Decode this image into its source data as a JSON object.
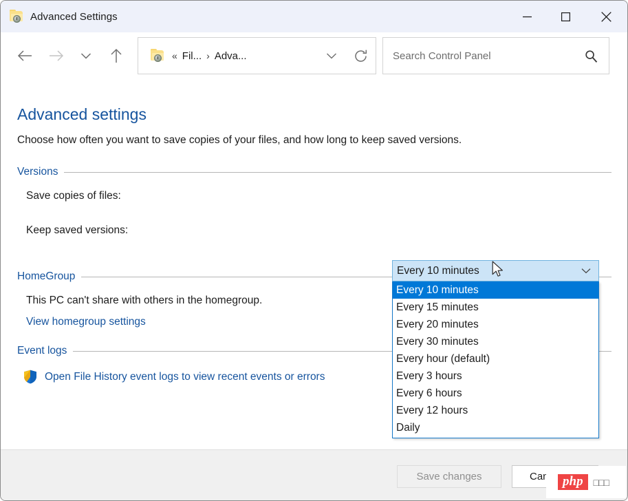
{
  "window": {
    "title": "Advanced Settings",
    "icon": "file-history-folder-icon",
    "controls": {
      "minimize": "minimize-icon",
      "maximize": "maximize-icon",
      "close": "close-icon"
    }
  },
  "toolbar": {
    "back": "back-arrow-icon",
    "forward": "forward-arrow-icon",
    "recent": "chevron-down-icon",
    "up": "up-arrow-icon",
    "address": {
      "icon": "file-history-folder-icon",
      "overflow": "«",
      "crumbs": [
        "Fil...",
        "Adva..."
      ],
      "separator": "›",
      "dropdown": "chevron-down-icon",
      "refresh": "refresh-icon"
    },
    "search": {
      "placeholder": "Search Control Panel",
      "value": "",
      "icon": "search-icon"
    }
  },
  "page": {
    "title": "Advanced settings",
    "subtitle": "Choose how often you want to save copies of your files, and how long to keep saved versions."
  },
  "groups": {
    "versions": {
      "label": "Versions",
      "save_copies_label": "Save copies of files:",
      "keep_versions_label": "Keep saved versions:"
    },
    "homegroup": {
      "label": "HomeGroup",
      "text": "This PC can't share with others in the homegroup.",
      "link": "View homegroup settings"
    },
    "event_logs": {
      "label": "Event logs",
      "shield_icon": "uac-shield-icon",
      "link": "Open File History event logs to view recent events or errors"
    }
  },
  "combo": {
    "selected_value": "Every 10 minutes",
    "chevron": "chevron-down-icon",
    "options": [
      "Every 10 minutes",
      "Every 15 minutes",
      "Every 20 minutes",
      "Every 30 minutes",
      "Every hour (default)",
      "Every 3 hours",
      "Every 6 hours",
      "Every 12 hours",
      "Daily"
    ],
    "selected_index": 0
  },
  "footer": {
    "save_label": "Save changes",
    "cancel_label": "Cancel"
  },
  "watermark": {
    "badge": "php",
    "text": "□□□"
  },
  "colors": {
    "accent_link": "#16549e",
    "titlebar_bg": "#eef1fa",
    "combo_bg": "#cce4f7",
    "selection_bg": "#0078d7",
    "footer_bg": "#f0f0f0",
    "watermark_badge": "#ef4444"
  }
}
